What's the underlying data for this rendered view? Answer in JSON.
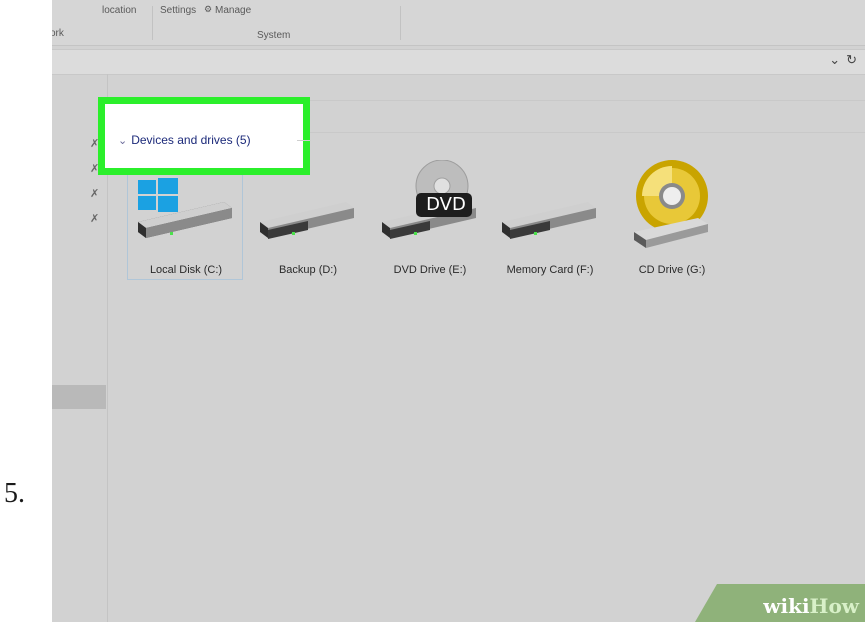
{
  "step_number": "5.",
  "ribbon": {
    "items": [
      "location",
      "Settings",
      "Manage",
      "ork",
      "System"
    ]
  },
  "address_bar": {
    "dropdown_icon": "chevron-down-icon",
    "refresh_icon": "refresh-icon"
  },
  "group": {
    "header": "Devices and drives (5)",
    "highlight_color": "#2bef2b"
  },
  "drives": [
    {
      "label": "Local Disk (C:)",
      "icon": "windows-drive-icon",
      "selected": true
    },
    {
      "label": "Backup (D:)",
      "icon": "hard-drive-icon",
      "selected": false
    },
    {
      "label": "DVD Drive (E:)",
      "icon": "dvd-drive-icon",
      "badge": "DVD",
      "selected": false
    },
    {
      "label": "Memory Card (F:)",
      "icon": "hard-drive-icon",
      "selected": false
    },
    {
      "label": "CD Drive (G:)",
      "icon": "cd-drive-icon",
      "selected": false
    }
  ],
  "watermark": {
    "wiki": "wiki",
    "how": "How"
  }
}
